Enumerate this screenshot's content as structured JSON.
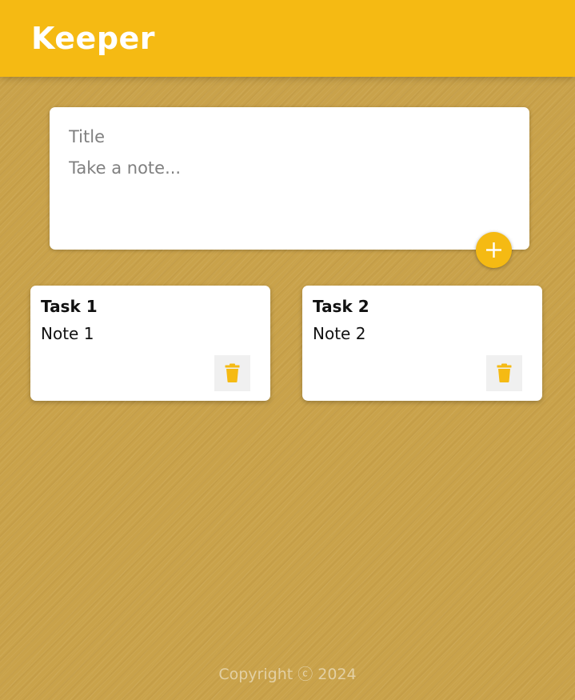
{
  "header": {
    "app_title": "Keeper"
  },
  "create_note": {
    "title_placeholder": "Title",
    "content_placeholder": "Take a note...",
    "title_value": "",
    "content_value": "",
    "add_icon": "plus-icon"
  },
  "notes": [
    {
      "title": "Task 1",
      "content": "Note 1",
      "delete_icon": "trash-icon"
    },
    {
      "title": "Task 2",
      "content": "Note 2",
      "delete_icon": "trash-icon"
    }
  ],
  "footer": {
    "copyright": "Copyright ⓒ 2024"
  },
  "colors": {
    "accent": "#f5ba13",
    "background": "#c9a24a",
    "card": "#ffffff",
    "delete_button_bg": "#f0f0f0"
  }
}
